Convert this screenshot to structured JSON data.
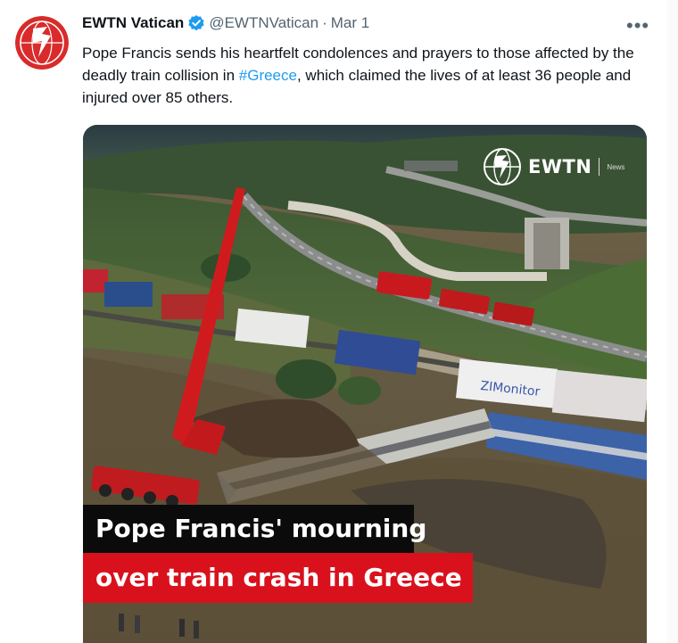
{
  "post": {
    "author_name": "EWTN Vatican",
    "handle": "@EWTNVatican",
    "separator": "·",
    "date": "Mar 1",
    "more_label": "•••",
    "text_part1": "Pope Francis sends his heartfelt condolences and prayers to those affected by the deadly train collision in ",
    "hashtag": "#Greece",
    "text_part2": ", which claimed the lives of at least 36 people and injured over 85 others."
  },
  "media": {
    "logo_text": "EWTN",
    "logo_subtext": "News",
    "caption_line1": "Pope Francis' mourning",
    "caption_line2": "over train crash in Greece"
  },
  "colors": {
    "link": "#1d9bf0",
    "verified": "#1d9bf0",
    "caption_red": "#d9111d",
    "avatar_red": "#d92b2b"
  },
  "icons": {
    "verified": "verified-badge-icon",
    "more": "more-options-icon",
    "avatar": "ewtn-logo-icon"
  }
}
